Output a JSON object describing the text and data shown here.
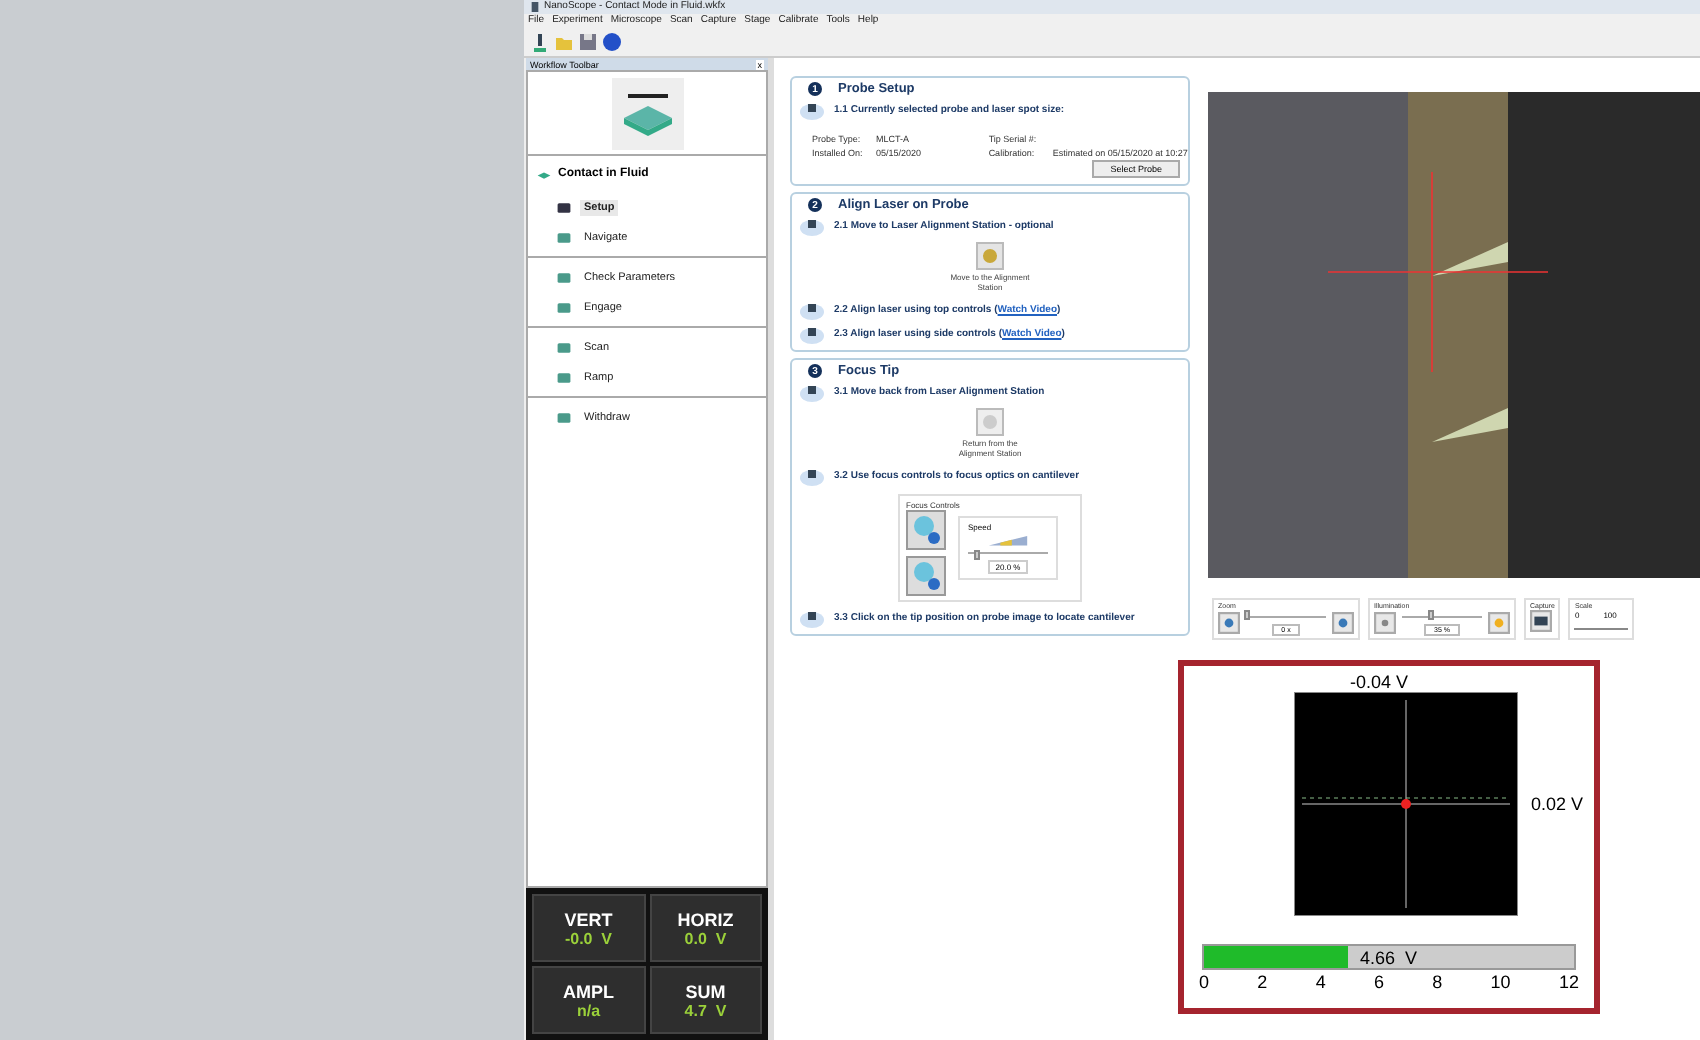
{
  "window": {
    "title": "NanoScope - Contact Mode in Fluid.wkfx"
  },
  "menu": [
    "File",
    "Experiment",
    "Microscope",
    "Scan",
    "Capture",
    "Stage",
    "Calibrate",
    "Tools",
    "Help"
  ],
  "workflow_toolbar": {
    "title": "Workflow Toolbar",
    "close": "x",
    "workflow": "Contact in Fluid",
    "groups": [
      {
        "items": [
          {
            "label": "Setup",
            "selected": true
          },
          {
            "label": "Navigate",
            "selected": false
          }
        ]
      },
      {
        "items": [
          {
            "label": "Check Parameters",
            "selected": false
          },
          {
            "label": "Engage",
            "selected": false
          }
        ]
      },
      {
        "items": [
          {
            "label": "Scan",
            "selected": false
          },
          {
            "label": "Ramp",
            "selected": false
          }
        ]
      },
      {
        "items": [
          {
            "label": "Withdraw",
            "selected": false
          }
        ]
      }
    ]
  },
  "readouts": [
    {
      "label": "VERT",
      "value": "-0.0  V"
    },
    {
      "label": "HORIZ",
      "value": "0.0  V"
    },
    {
      "label": "AMPL",
      "value": "n/a"
    },
    {
      "label": "SUM",
      "value": "4.7  V"
    }
  ],
  "steps": [
    {
      "number": "1",
      "title": "Probe Setup",
      "substeps": [
        {
          "text": "1.1 Currently selected probe and laser spot size:"
        }
      ],
      "probe": {
        "fields": [
          {
            "label": "Probe Type:",
            "value": "MLCT-A"
          },
          {
            "label": "Tip Serial #:"
          },
          {
            "label": "Installed On:",
            "value": "05/15/2020"
          },
          {
            "label": "Calibration:",
            "value": "Estimated on 05/15/2020 at 10:27"
          }
        ],
        "button": "Select Probe"
      }
    },
    {
      "number": "2",
      "title": "Align Laser on Probe",
      "substeps": [
        {
          "text": "2.1 Move to Laser Alignment Station - optional",
          "action": "Move to the Alignment Station",
          "action_disabled": false
        },
        {
          "text": "2.2 Align laser using top controls (",
          "link": "Watch Video",
          "after": ")"
        },
        {
          "text": "2.3 Align laser using side controls (",
          "link": "Watch Video",
          "after": ")"
        }
      ]
    },
    {
      "number": "3",
      "title": "Focus Tip",
      "substeps": [
        {
          "text": "3.1 Move back from Laser Alignment Station",
          "action": "Return from the Alignment Station",
          "action_disabled": true
        },
        {
          "text": "3.2 Use focus controls to focus optics on cantilever",
          "focus": {
            "title": "Focus Controls",
            "speed_label": "Speed",
            "level": 0.1,
            "value": "20.0 %"
          }
        },
        {
          "text": "3.3 Click on the tip position on probe image to locate cantilever"
        }
      ]
    }
  ],
  "camera": {
    "zoom": {
      "label": "Zoom",
      "level": 0.0,
      "value": "0 x"
    },
    "illumination": {
      "label": "Illumination",
      "level": 0.35,
      "value": "35 %"
    },
    "capture": "Capture",
    "scale": {
      "label": "Scale",
      "ticks": [
        "0",
        "100"
      ]
    }
  },
  "detector": {
    "vertical": "-0.04 V",
    "horizontal": "0.02 V",
    "sum": {
      "level": 0.388,
      "reading": "4.66  V"
    },
    "ticks": [
      "0",
      "2",
      "4",
      "6",
      "8",
      "10",
      "12"
    ]
  }
}
